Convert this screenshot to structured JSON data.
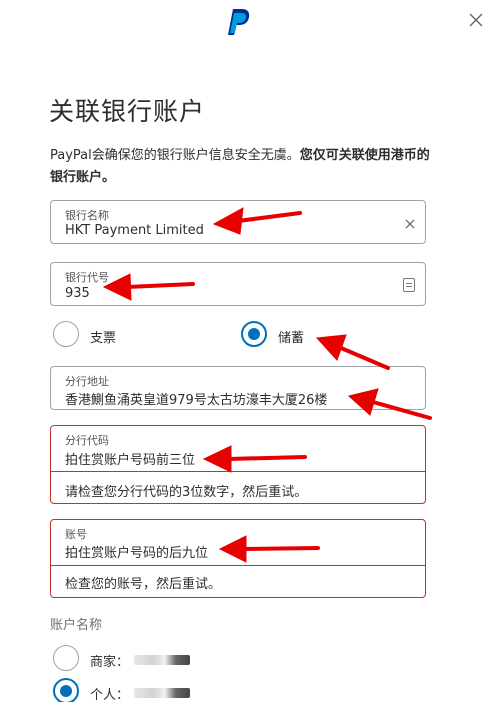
{
  "header": {
    "logo_icon": "paypal-logo-icon",
    "close_icon": "close-icon"
  },
  "title": "关联银行账户",
  "intro": {
    "normal": "PayPal会确保您的银行账户信息安全无虞。",
    "bold": "您仅可关联使用港币的银行账户。"
  },
  "bank_name": {
    "label": "银行名称",
    "value": "HKT Payment Limited",
    "clear_icon": "clear-icon"
  },
  "bank_code": {
    "label": "银行代号",
    "value": "935",
    "card_icon": "card-icon"
  },
  "account_type": {
    "options": [
      {
        "label": "支票",
        "selected": false
      },
      {
        "label": "储蓄",
        "selected": true
      }
    ]
  },
  "branch_address": {
    "label": "分行地址",
    "value": "香港鰂鱼涌英皇道979号太古坊濠丰大厦26楼"
  },
  "branch_code": {
    "label": "分行代码",
    "value": "拍住赏账户号码前三位",
    "error": "请检查您分行代码的3位数字，然后重试。"
  },
  "account_number": {
    "label": "账号",
    "value": "拍住赏账户号码的后九位",
    "error": "检查您的账号，然后重试。"
  },
  "account_name": {
    "section_label": "账户名称",
    "options": [
      {
        "label": "商家：",
        "selected": false
      },
      {
        "label": "个人：",
        "selected": true
      }
    ]
  },
  "colors": {
    "accent": "#0070ba",
    "error": "#c72e2e",
    "annotation": "#e60000"
  }
}
